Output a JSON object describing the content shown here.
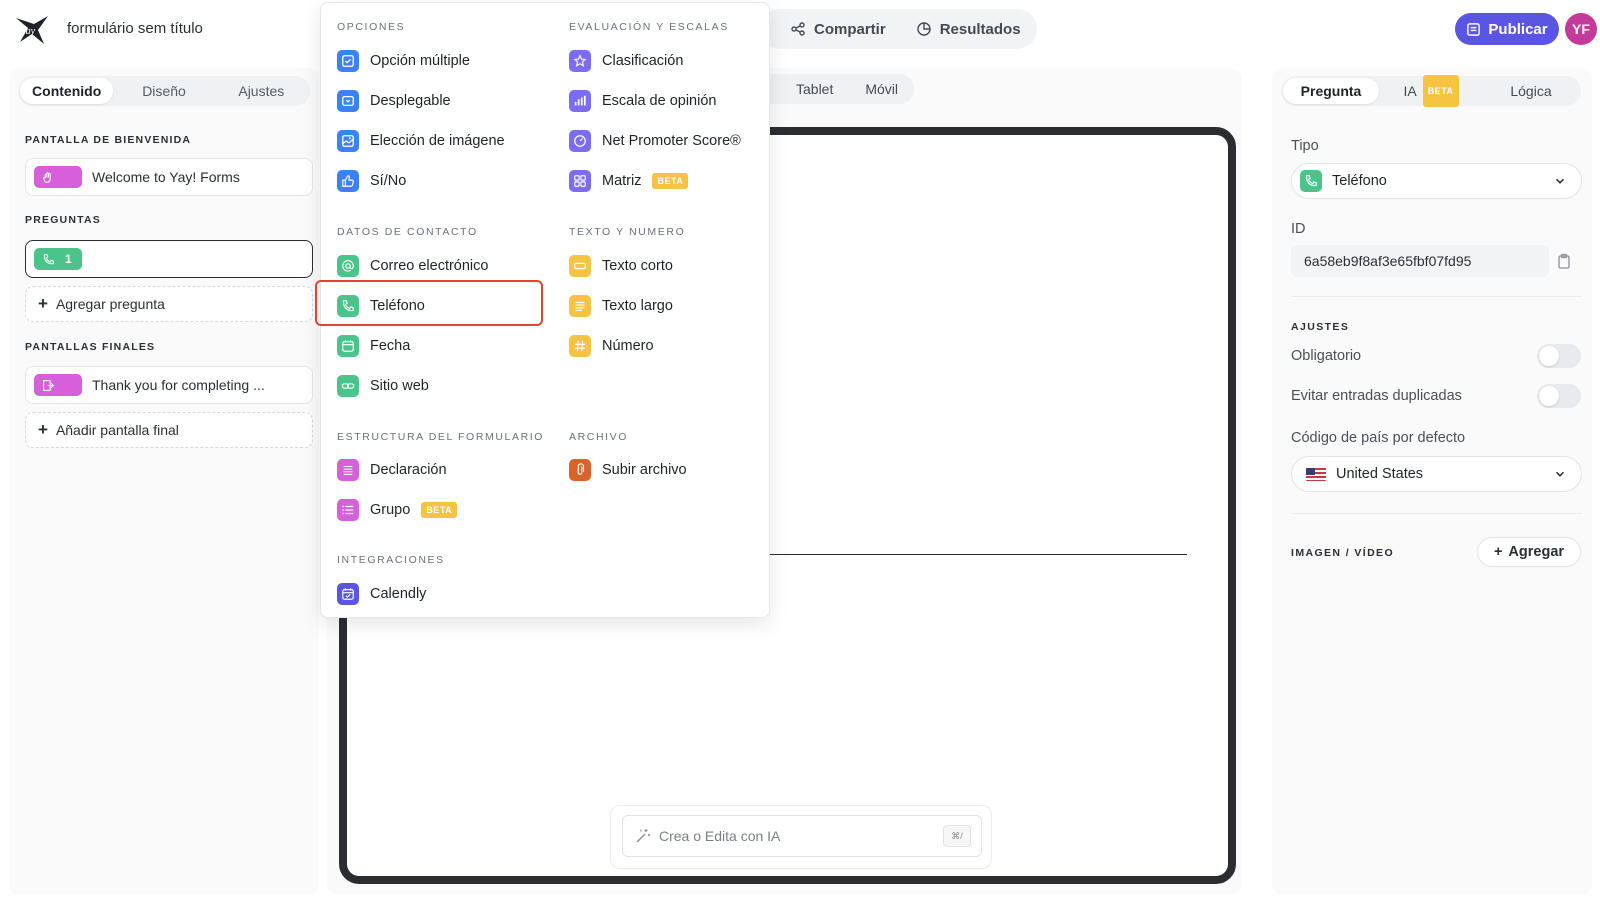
{
  "app": {
    "form_title": "formulário sem título",
    "topnav": {
      "share": "Compartir",
      "results": "Resultados"
    },
    "publish": "Publicar",
    "avatar_initials": "YF",
    "accent": "#5b55e3"
  },
  "left": {
    "tabs": [
      "Contenido",
      "Diseño",
      "Ajustes"
    ],
    "welcome_label": "PANTALLA DE BIENVENIDA",
    "welcome_item": "Welcome to Yay! Forms",
    "questions_label": "PREGUNTAS",
    "question_number": "1",
    "add_question": "Agregar pregunta",
    "endings_label": "PANTALLAS FINALES",
    "ending_item": "Thank you for completing ...",
    "add_ending": "Añadir pantalla final"
  },
  "center": {
    "views": [
      "Tablet",
      "Móvil"
    ],
    "ai_placeholder": "Crea o Edita con IA",
    "ai_shortcut": "⌘/"
  },
  "menu": {
    "groups": {
      "options": "OPCIONES",
      "rating": "EVALUACIÓN Y ESCALAS",
      "contact": "DATOS DE CONTACTO",
      "text": "TEXTO Y NUMERO",
      "structure": "ESTRUCTURA DEL FORMULARIO",
      "file": "ARCHIVO",
      "integrations": "INTEGRACIONES"
    },
    "items": {
      "multiple_choice": "Opción múltiple",
      "dropdown": "Desplegable",
      "picture_choice": "Elección de imágene",
      "yes_no": "Sí/No",
      "ranking": "Clasificación",
      "opinion_scale": "Escala de opinión",
      "nps": "Net Promoter Score®",
      "matrix": "Matriz",
      "email": "Correo electrónico",
      "phone": "Teléfono",
      "date": "Fecha",
      "website": "Sitio web",
      "short_text": "Texto corto",
      "long_text": "Texto largo",
      "number": "Número",
      "statement": "Declaración",
      "group": "Grupo",
      "upload": "Subir archivo",
      "calendly": "Calendly"
    },
    "beta": "BETA"
  },
  "right": {
    "tabs": {
      "question": "Pregunta",
      "ai": "IA",
      "logic": "Lógica"
    },
    "type_label": "Tipo",
    "type_value": "Teléfono",
    "id_label": "ID",
    "id_value": "6a58eb9f8af3e65fbf07fd95",
    "settings_label": "AJUSTES",
    "required": "Obligatorio",
    "no_duplicates": "Evitar entradas duplicadas",
    "country_code_label": "Código de país por defecto",
    "country_value": "United States",
    "media_label": "IMAGEN / VÍDEO",
    "add_media": "Agregar"
  },
  "colors": {
    "blue": "#3b82f6",
    "purple": "#7c6cf0",
    "green": "#4cc38a",
    "yellow": "#f6c343",
    "pink": "#d65fdc",
    "orange": "#d9642b",
    "indigo": "#5b55e3",
    "highlight": "#e0432f"
  }
}
